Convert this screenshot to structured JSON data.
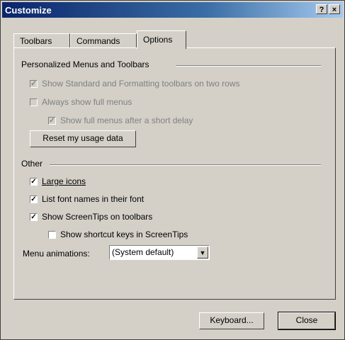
{
  "window": {
    "title": "Customize",
    "help_glyph": "?",
    "close_glyph": "×"
  },
  "tabs": [
    {
      "label": "Toolbars"
    },
    {
      "label": "Commands"
    },
    {
      "label": "Options"
    }
  ],
  "personalized": {
    "heading": "Personalized Menus and Toolbars",
    "opt1": {
      "label": "Show Standard and Formatting toolbars on two rows",
      "checked": true,
      "disabled": true
    },
    "opt2": {
      "label": "Always show full menus",
      "checked": false,
      "disabled": true
    },
    "opt3": {
      "label": "Show full menus after a short delay",
      "checked": true,
      "disabled": true
    },
    "reset_label": "Reset my usage data"
  },
  "other": {
    "heading": "Other",
    "large_icons": {
      "label": "Large icons",
      "checked": true
    },
    "font_names": {
      "label": "List font names in their font",
      "checked": true
    },
    "screentips": {
      "label": "Show ScreenTips on toolbars",
      "checked": true
    },
    "shortcut_keys": {
      "label": "Show shortcut keys in ScreenTips",
      "checked": false
    },
    "animations_label": "Menu animations:",
    "animations_value": "(System default)"
  },
  "footer": {
    "keyboard_label": "Keyboard...",
    "close_label": "Close"
  },
  "glyphs": {
    "check": "✓",
    "dropdown": "▼"
  }
}
